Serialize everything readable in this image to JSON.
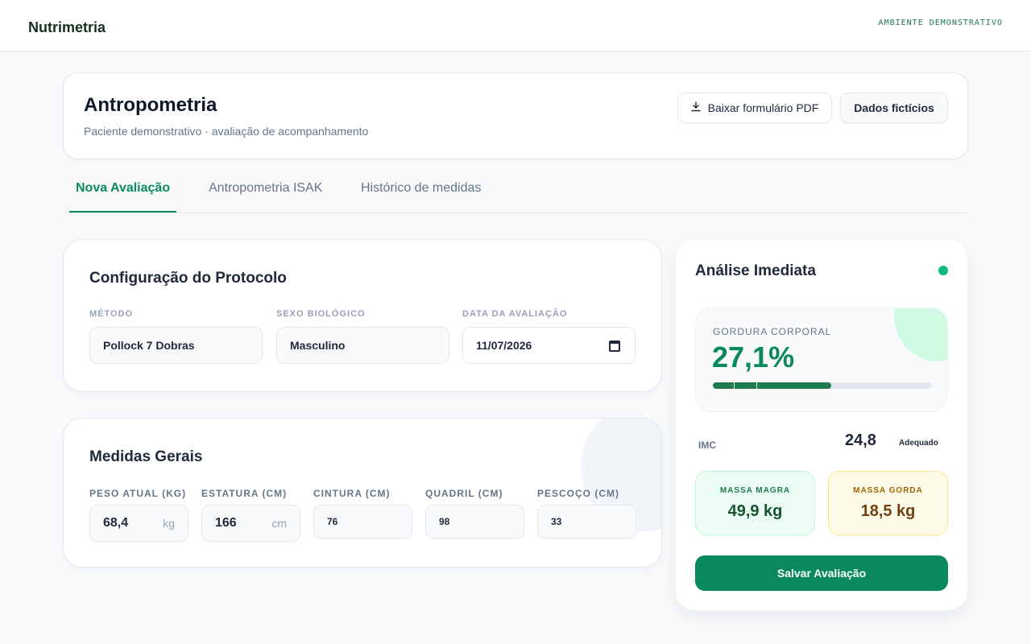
{
  "app": {
    "brand": "Nutrimetria",
    "environment": "AMBIENTE DEMONSTRATIVO"
  },
  "header": {
    "title": "Antropometria",
    "subtitle": "Paciente demonstrativo · avaliação de acompanhamento",
    "download_label": "Baixar formulário PDF",
    "download_icon": "download-icon",
    "fictitious_label": "Dados fictícios"
  },
  "tabs": [
    {
      "label": "Nova Avaliação",
      "active": true
    },
    {
      "label": "Antropometria ISAK",
      "active": false
    },
    {
      "label": "Histórico de medidas",
      "active": false
    }
  ],
  "protocol": {
    "title": "Configuração do Protocolo",
    "method_label": "MÉTODO",
    "method_value": "Pollock 7 Dobras",
    "sex_label": "SEXO BIOLÓGICO",
    "sex_value": "Masculino",
    "date_label": "DATA DA AVALIAÇÃO",
    "date_value": "11/07/2026"
  },
  "measures": {
    "title": "Medidas Gerais",
    "weight_label": "PESO ATUAL (KG)",
    "weight_value": "68,4",
    "weight_unit": "kg",
    "height_label": "ESTATURA (CM)",
    "height_value": "166",
    "height_unit": "cm",
    "waist_label": "CINTURA (CM)",
    "waist_value": "76",
    "hip_label": "QUADRIL (CM)",
    "hip_value": "98",
    "neck_label": "PESCOÇO (CM)",
    "neck_value": "33"
  },
  "analysis": {
    "title": "Análise Imediata",
    "status_color": "#10b981",
    "body_fat_label": "GORDURA CORPORAL",
    "body_fat_value": "27,1%",
    "body_fat_fraction": 0.54,
    "imc_label": "IMC",
    "imc_value": "24,8",
    "imc_status": "Adequado",
    "lean_label": "MASSA MAGRA",
    "lean_value": "49,9 kg",
    "fat_label": "MASSA GORDA",
    "fat_value": "18,5 kg",
    "save_label": "Salvar Avaliação"
  },
  "colors": {
    "accent": "#0a8a5c",
    "bar_fill": "#1f7a4c"
  }
}
